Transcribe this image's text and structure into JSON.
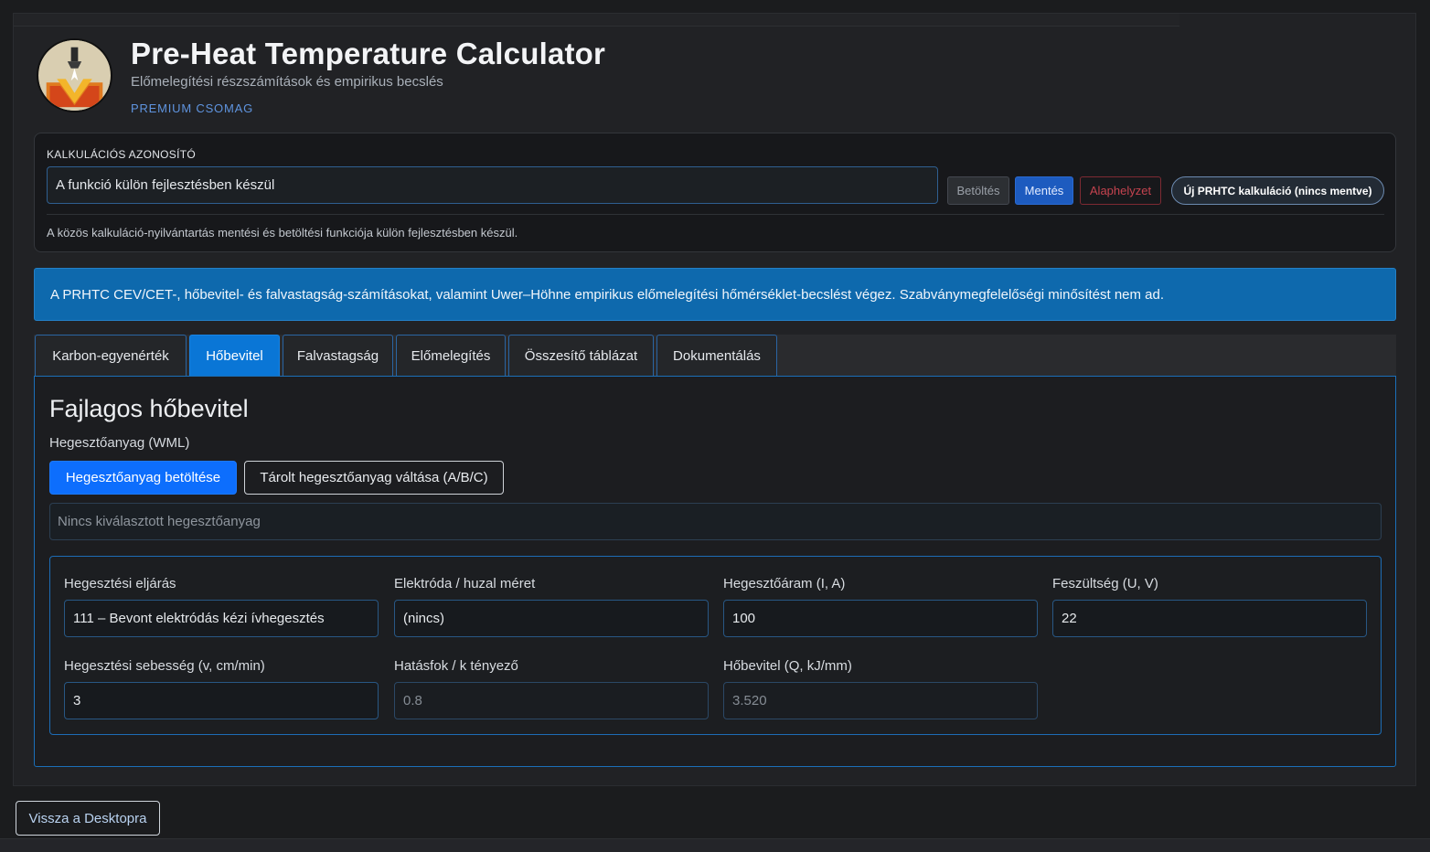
{
  "header": {
    "title": "Pre-Heat Temperature Calculator",
    "subtitle": "Előmelegítési részszámítások és empirikus becslés",
    "package": "PREMIUM CSOMAG",
    "logo_icon": "flame-torch-logo-icon"
  },
  "calc_id": {
    "label": "KALKULÁCIÓS AZONOSÍTÓ",
    "value": "A funkció külön fejlesztésben készül",
    "buttons": {
      "load": "Betöltés",
      "save": "Mentés",
      "reset": "Alaphelyzet",
      "new": "Új PRHTC kalkuláció (nincs mentve)"
    },
    "note": "A közös kalkuláció-nyilvántartás mentési és betöltési funkciója külön fejlesztésben készül."
  },
  "banner": {
    "text": "A PRHTC CEV/CET-, hőbevitel- és falvastagság-számításokat, valamint Uwer–Höhne empirikus előmelegítési hőmérséklet-becslést végez. Szabványmegfelelőségi minősítést nem ad."
  },
  "tabs": [
    {
      "label": "Karbon-egyenérték",
      "active": false
    },
    {
      "label": "Hőbevitel",
      "active": true
    },
    {
      "label": "Falvastagság",
      "active": false
    },
    {
      "label": "Előmelegítés",
      "active": false
    },
    {
      "label": "Összesítő táblázat",
      "active": false
    },
    {
      "label": "Dokumentálás",
      "active": false
    }
  ],
  "panel": {
    "heading": "Fajlagos hőbevitel",
    "wml_label": "Hegesztőanyag (WML)",
    "load_wml_button": "Hegesztőanyag betöltése",
    "switch_wml_button": "Tárolt hegesztőanyag váltása (A/B/C)",
    "wml_placeholder": "Nincs kiválasztott hegesztőanyag",
    "fields": {
      "process": {
        "label": "Hegesztési eljárás",
        "value": "111 – Bevont elektródás kézi ívhegesztés"
      },
      "electrode": {
        "label": "Elektróda / huzal méret",
        "value": "(nincs)"
      },
      "current": {
        "label": "Hegesztőáram (I, A)",
        "value": "100"
      },
      "voltage": {
        "label": "Feszültség (U, V)",
        "value": "22"
      },
      "speed": {
        "label": "Hegesztési sebesség (v, cm/min)",
        "value": "3"
      },
      "efficiency": {
        "label": "Hatásfok / k tényező",
        "value": "0.8"
      },
      "heat_input": {
        "label": "Hőbevitel (Q, kJ/mm)",
        "value": "3.520"
      }
    }
  },
  "footer": {
    "back_button": "Vissza a Desktopra"
  },
  "colors": {
    "accent": "#0d6efd",
    "tab_active": "#0a76d6",
    "banner": "#0e69ad",
    "danger": "#c4434f",
    "premium": "#5f94df"
  }
}
